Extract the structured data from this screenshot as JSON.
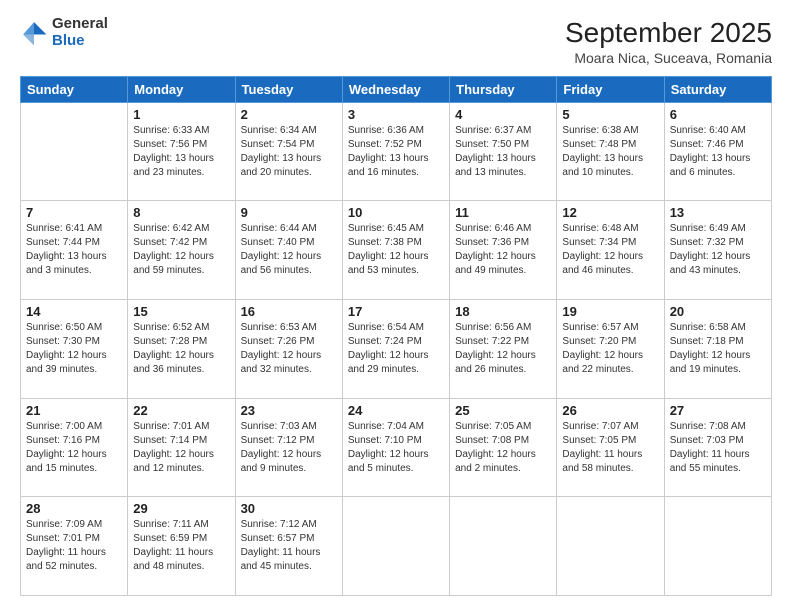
{
  "logo": {
    "general": "General",
    "blue": "Blue"
  },
  "header": {
    "title": "September 2025",
    "subtitle": "Moara Nica, Suceava, Romania"
  },
  "weekdays": [
    "Sunday",
    "Monday",
    "Tuesday",
    "Wednesday",
    "Thursday",
    "Friday",
    "Saturday"
  ],
  "weeks": [
    [
      {
        "day": "",
        "info": ""
      },
      {
        "day": "1",
        "info": "Sunrise: 6:33 AM\nSunset: 7:56 PM\nDaylight: 13 hours\nand 23 minutes."
      },
      {
        "day": "2",
        "info": "Sunrise: 6:34 AM\nSunset: 7:54 PM\nDaylight: 13 hours\nand 20 minutes."
      },
      {
        "day": "3",
        "info": "Sunrise: 6:36 AM\nSunset: 7:52 PM\nDaylight: 13 hours\nand 16 minutes."
      },
      {
        "day": "4",
        "info": "Sunrise: 6:37 AM\nSunset: 7:50 PM\nDaylight: 13 hours\nand 13 minutes."
      },
      {
        "day": "5",
        "info": "Sunrise: 6:38 AM\nSunset: 7:48 PM\nDaylight: 13 hours\nand 10 minutes."
      },
      {
        "day": "6",
        "info": "Sunrise: 6:40 AM\nSunset: 7:46 PM\nDaylight: 13 hours\nand 6 minutes."
      }
    ],
    [
      {
        "day": "7",
        "info": "Sunrise: 6:41 AM\nSunset: 7:44 PM\nDaylight: 13 hours\nand 3 minutes."
      },
      {
        "day": "8",
        "info": "Sunrise: 6:42 AM\nSunset: 7:42 PM\nDaylight: 12 hours\nand 59 minutes."
      },
      {
        "day": "9",
        "info": "Sunrise: 6:44 AM\nSunset: 7:40 PM\nDaylight: 12 hours\nand 56 minutes."
      },
      {
        "day": "10",
        "info": "Sunrise: 6:45 AM\nSunset: 7:38 PM\nDaylight: 12 hours\nand 53 minutes."
      },
      {
        "day": "11",
        "info": "Sunrise: 6:46 AM\nSunset: 7:36 PM\nDaylight: 12 hours\nand 49 minutes."
      },
      {
        "day": "12",
        "info": "Sunrise: 6:48 AM\nSunset: 7:34 PM\nDaylight: 12 hours\nand 46 minutes."
      },
      {
        "day": "13",
        "info": "Sunrise: 6:49 AM\nSunset: 7:32 PM\nDaylight: 12 hours\nand 43 minutes."
      }
    ],
    [
      {
        "day": "14",
        "info": "Sunrise: 6:50 AM\nSunset: 7:30 PM\nDaylight: 12 hours\nand 39 minutes."
      },
      {
        "day": "15",
        "info": "Sunrise: 6:52 AM\nSunset: 7:28 PM\nDaylight: 12 hours\nand 36 minutes."
      },
      {
        "day": "16",
        "info": "Sunrise: 6:53 AM\nSunset: 7:26 PM\nDaylight: 12 hours\nand 32 minutes."
      },
      {
        "day": "17",
        "info": "Sunrise: 6:54 AM\nSunset: 7:24 PM\nDaylight: 12 hours\nand 29 minutes."
      },
      {
        "day": "18",
        "info": "Sunrise: 6:56 AM\nSunset: 7:22 PM\nDaylight: 12 hours\nand 26 minutes."
      },
      {
        "day": "19",
        "info": "Sunrise: 6:57 AM\nSunset: 7:20 PM\nDaylight: 12 hours\nand 22 minutes."
      },
      {
        "day": "20",
        "info": "Sunrise: 6:58 AM\nSunset: 7:18 PM\nDaylight: 12 hours\nand 19 minutes."
      }
    ],
    [
      {
        "day": "21",
        "info": "Sunrise: 7:00 AM\nSunset: 7:16 PM\nDaylight: 12 hours\nand 15 minutes."
      },
      {
        "day": "22",
        "info": "Sunrise: 7:01 AM\nSunset: 7:14 PM\nDaylight: 12 hours\nand 12 minutes."
      },
      {
        "day": "23",
        "info": "Sunrise: 7:03 AM\nSunset: 7:12 PM\nDaylight: 12 hours\nand 9 minutes."
      },
      {
        "day": "24",
        "info": "Sunrise: 7:04 AM\nSunset: 7:10 PM\nDaylight: 12 hours\nand 5 minutes."
      },
      {
        "day": "25",
        "info": "Sunrise: 7:05 AM\nSunset: 7:08 PM\nDaylight: 12 hours\nand 2 minutes."
      },
      {
        "day": "26",
        "info": "Sunrise: 7:07 AM\nSunset: 7:05 PM\nDaylight: 11 hours\nand 58 minutes."
      },
      {
        "day": "27",
        "info": "Sunrise: 7:08 AM\nSunset: 7:03 PM\nDaylight: 11 hours\nand 55 minutes."
      }
    ],
    [
      {
        "day": "28",
        "info": "Sunrise: 7:09 AM\nSunset: 7:01 PM\nDaylight: 11 hours\nand 52 minutes."
      },
      {
        "day": "29",
        "info": "Sunrise: 7:11 AM\nSunset: 6:59 PM\nDaylight: 11 hours\nand 48 minutes."
      },
      {
        "day": "30",
        "info": "Sunrise: 7:12 AM\nSunset: 6:57 PM\nDaylight: 11 hours\nand 45 minutes."
      },
      {
        "day": "",
        "info": ""
      },
      {
        "day": "",
        "info": ""
      },
      {
        "day": "",
        "info": ""
      },
      {
        "day": "",
        "info": ""
      }
    ]
  ]
}
